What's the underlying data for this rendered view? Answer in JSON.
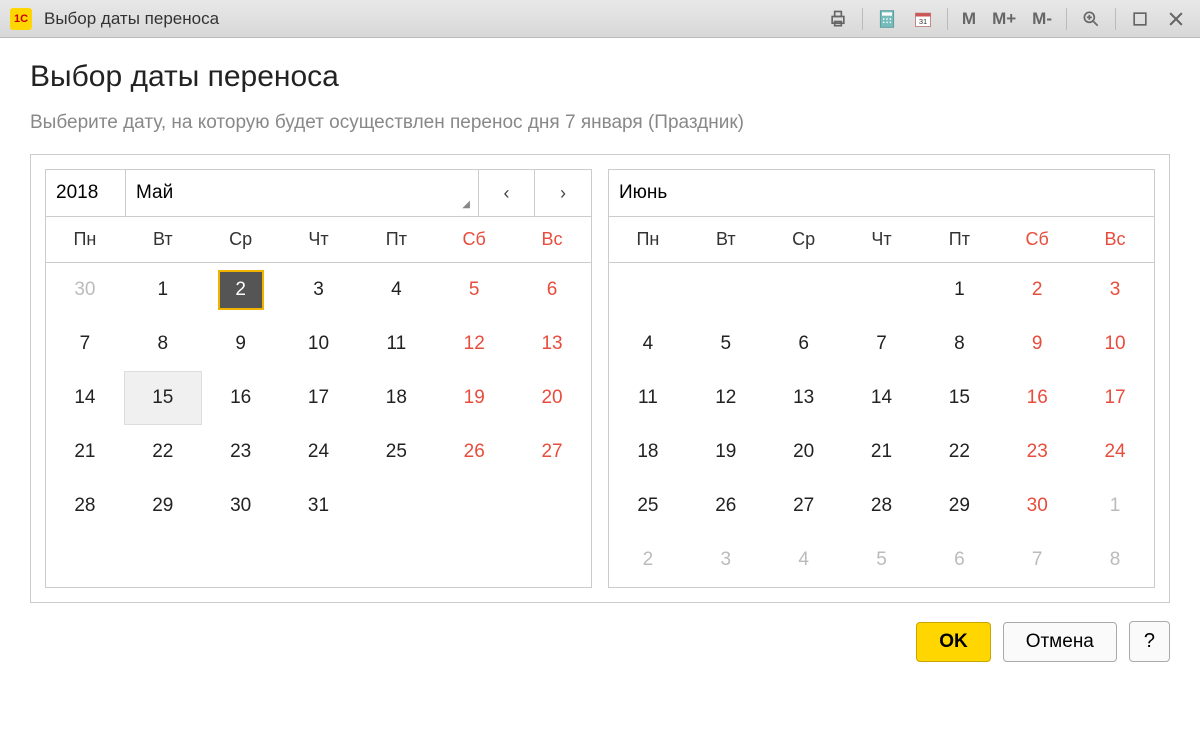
{
  "titlebar": {
    "app_label": "1C",
    "title": "Выбор даты переноса",
    "tools": {
      "m": "M",
      "mplus": "M+",
      "mminus": "M-"
    }
  },
  "page": {
    "heading": "Выбор даты переноса",
    "instruction": "Выберите дату, на которую будет осуществлен перенос дня 7 января (Праздник)"
  },
  "dow": [
    "Пн",
    "Вт",
    "Ср",
    "Чт",
    "Пт",
    "Сб",
    "Вс"
  ],
  "nav": {
    "prev": "‹",
    "next": "›"
  },
  "month1": {
    "year": "2018",
    "name": "Май",
    "days": [
      {
        "n": "30",
        "out": true
      },
      {
        "n": "1"
      },
      {
        "n": "2",
        "sel": true
      },
      {
        "n": "3"
      },
      {
        "n": "4"
      },
      {
        "n": "5",
        "wknd": true
      },
      {
        "n": "6",
        "wknd": true
      },
      {
        "n": "7"
      },
      {
        "n": "8"
      },
      {
        "n": "9"
      },
      {
        "n": "10"
      },
      {
        "n": "11"
      },
      {
        "n": "12",
        "wknd": true
      },
      {
        "n": "13",
        "wknd": true
      },
      {
        "n": "14"
      },
      {
        "n": "15",
        "hov": true
      },
      {
        "n": "16"
      },
      {
        "n": "17"
      },
      {
        "n": "18"
      },
      {
        "n": "19",
        "wknd": true
      },
      {
        "n": "20",
        "wknd": true
      },
      {
        "n": "21"
      },
      {
        "n": "22"
      },
      {
        "n": "23"
      },
      {
        "n": "24"
      },
      {
        "n": "25"
      },
      {
        "n": "26",
        "wknd": true
      },
      {
        "n": "27",
        "wknd": true
      },
      {
        "n": "28"
      },
      {
        "n": "29"
      },
      {
        "n": "30"
      },
      {
        "n": "31"
      },
      {
        "n": ""
      },
      {
        "n": ""
      },
      {
        "n": ""
      },
      {
        "n": ""
      },
      {
        "n": ""
      },
      {
        "n": ""
      },
      {
        "n": ""
      },
      {
        "n": ""
      },
      {
        "n": ""
      },
      {
        "n": ""
      }
    ]
  },
  "month2": {
    "name": "Июнь",
    "days": [
      {
        "n": ""
      },
      {
        "n": ""
      },
      {
        "n": ""
      },
      {
        "n": ""
      },
      {
        "n": "1"
      },
      {
        "n": "2",
        "wknd": true
      },
      {
        "n": "3",
        "wknd": true
      },
      {
        "n": "4"
      },
      {
        "n": "5"
      },
      {
        "n": "6"
      },
      {
        "n": "7"
      },
      {
        "n": "8"
      },
      {
        "n": "9",
        "wknd": true
      },
      {
        "n": "10",
        "wknd": true
      },
      {
        "n": "11"
      },
      {
        "n": "12"
      },
      {
        "n": "13"
      },
      {
        "n": "14"
      },
      {
        "n": "15"
      },
      {
        "n": "16",
        "wknd": true
      },
      {
        "n": "17",
        "wknd": true
      },
      {
        "n": "18"
      },
      {
        "n": "19"
      },
      {
        "n": "20"
      },
      {
        "n": "21"
      },
      {
        "n": "22"
      },
      {
        "n": "23",
        "wknd": true
      },
      {
        "n": "24",
        "wknd": true
      },
      {
        "n": "25"
      },
      {
        "n": "26"
      },
      {
        "n": "27"
      },
      {
        "n": "28"
      },
      {
        "n": "29"
      },
      {
        "n": "30",
        "wknd": true
      },
      {
        "n": "1",
        "out": true
      },
      {
        "n": "2",
        "out": true
      },
      {
        "n": "3",
        "out": true
      },
      {
        "n": "4",
        "out": true
      },
      {
        "n": "5",
        "out": true
      },
      {
        "n": "6",
        "out": true
      },
      {
        "n": "7",
        "out": true
      },
      {
        "n": "8",
        "out": true
      }
    ]
  },
  "footer": {
    "ok": "OK",
    "cancel": "Отмена",
    "help": "?"
  }
}
